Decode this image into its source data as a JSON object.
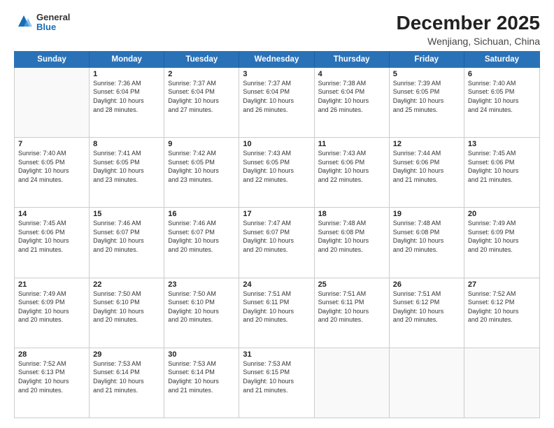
{
  "logo": {
    "general": "General",
    "blue": "Blue"
  },
  "title": "December 2025",
  "subtitle": "Wenjiang, Sichuan, China",
  "header_days": [
    "Sunday",
    "Monday",
    "Tuesday",
    "Wednesday",
    "Thursday",
    "Friday",
    "Saturday"
  ],
  "weeks": [
    [
      {
        "num": "",
        "info": ""
      },
      {
        "num": "1",
        "info": "Sunrise: 7:36 AM\nSunset: 6:04 PM\nDaylight: 10 hours\nand 28 minutes."
      },
      {
        "num": "2",
        "info": "Sunrise: 7:37 AM\nSunset: 6:04 PM\nDaylight: 10 hours\nand 27 minutes."
      },
      {
        "num": "3",
        "info": "Sunrise: 7:37 AM\nSunset: 6:04 PM\nDaylight: 10 hours\nand 26 minutes."
      },
      {
        "num": "4",
        "info": "Sunrise: 7:38 AM\nSunset: 6:04 PM\nDaylight: 10 hours\nand 26 minutes."
      },
      {
        "num": "5",
        "info": "Sunrise: 7:39 AM\nSunset: 6:05 PM\nDaylight: 10 hours\nand 25 minutes."
      },
      {
        "num": "6",
        "info": "Sunrise: 7:40 AM\nSunset: 6:05 PM\nDaylight: 10 hours\nand 24 minutes."
      }
    ],
    [
      {
        "num": "7",
        "info": "Sunrise: 7:40 AM\nSunset: 6:05 PM\nDaylight: 10 hours\nand 24 minutes."
      },
      {
        "num": "8",
        "info": "Sunrise: 7:41 AM\nSunset: 6:05 PM\nDaylight: 10 hours\nand 23 minutes."
      },
      {
        "num": "9",
        "info": "Sunrise: 7:42 AM\nSunset: 6:05 PM\nDaylight: 10 hours\nand 23 minutes."
      },
      {
        "num": "10",
        "info": "Sunrise: 7:43 AM\nSunset: 6:05 PM\nDaylight: 10 hours\nand 22 minutes."
      },
      {
        "num": "11",
        "info": "Sunrise: 7:43 AM\nSunset: 6:06 PM\nDaylight: 10 hours\nand 22 minutes."
      },
      {
        "num": "12",
        "info": "Sunrise: 7:44 AM\nSunset: 6:06 PM\nDaylight: 10 hours\nand 21 minutes."
      },
      {
        "num": "13",
        "info": "Sunrise: 7:45 AM\nSunset: 6:06 PM\nDaylight: 10 hours\nand 21 minutes."
      }
    ],
    [
      {
        "num": "14",
        "info": "Sunrise: 7:45 AM\nSunset: 6:06 PM\nDaylight: 10 hours\nand 21 minutes."
      },
      {
        "num": "15",
        "info": "Sunrise: 7:46 AM\nSunset: 6:07 PM\nDaylight: 10 hours\nand 20 minutes."
      },
      {
        "num": "16",
        "info": "Sunrise: 7:46 AM\nSunset: 6:07 PM\nDaylight: 10 hours\nand 20 minutes."
      },
      {
        "num": "17",
        "info": "Sunrise: 7:47 AM\nSunset: 6:07 PM\nDaylight: 10 hours\nand 20 minutes."
      },
      {
        "num": "18",
        "info": "Sunrise: 7:48 AM\nSunset: 6:08 PM\nDaylight: 10 hours\nand 20 minutes."
      },
      {
        "num": "19",
        "info": "Sunrise: 7:48 AM\nSunset: 6:08 PM\nDaylight: 10 hours\nand 20 minutes."
      },
      {
        "num": "20",
        "info": "Sunrise: 7:49 AM\nSunset: 6:09 PM\nDaylight: 10 hours\nand 20 minutes."
      }
    ],
    [
      {
        "num": "21",
        "info": "Sunrise: 7:49 AM\nSunset: 6:09 PM\nDaylight: 10 hours\nand 20 minutes."
      },
      {
        "num": "22",
        "info": "Sunrise: 7:50 AM\nSunset: 6:10 PM\nDaylight: 10 hours\nand 20 minutes."
      },
      {
        "num": "23",
        "info": "Sunrise: 7:50 AM\nSunset: 6:10 PM\nDaylight: 10 hours\nand 20 minutes."
      },
      {
        "num": "24",
        "info": "Sunrise: 7:51 AM\nSunset: 6:11 PM\nDaylight: 10 hours\nand 20 minutes."
      },
      {
        "num": "25",
        "info": "Sunrise: 7:51 AM\nSunset: 6:11 PM\nDaylight: 10 hours\nand 20 minutes."
      },
      {
        "num": "26",
        "info": "Sunrise: 7:51 AM\nSunset: 6:12 PM\nDaylight: 10 hours\nand 20 minutes."
      },
      {
        "num": "27",
        "info": "Sunrise: 7:52 AM\nSunset: 6:12 PM\nDaylight: 10 hours\nand 20 minutes."
      }
    ],
    [
      {
        "num": "28",
        "info": "Sunrise: 7:52 AM\nSunset: 6:13 PM\nDaylight: 10 hours\nand 20 minutes."
      },
      {
        "num": "29",
        "info": "Sunrise: 7:53 AM\nSunset: 6:14 PM\nDaylight: 10 hours\nand 21 minutes."
      },
      {
        "num": "30",
        "info": "Sunrise: 7:53 AM\nSunset: 6:14 PM\nDaylight: 10 hours\nand 21 minutes."
      },
      {
        "num": "31",
        "info": "Sunrise: 7:53 AM\nSunset: 6:15 PM\nDaylight: 10 hours\nand 21 minutes."
      },
      {
        "num": "",
        "info": ""
      },
      {
        "num": "",
        "info": ""
      },
      {
        "num": "",
        "info": ""
      }
    ]
  ]
}
